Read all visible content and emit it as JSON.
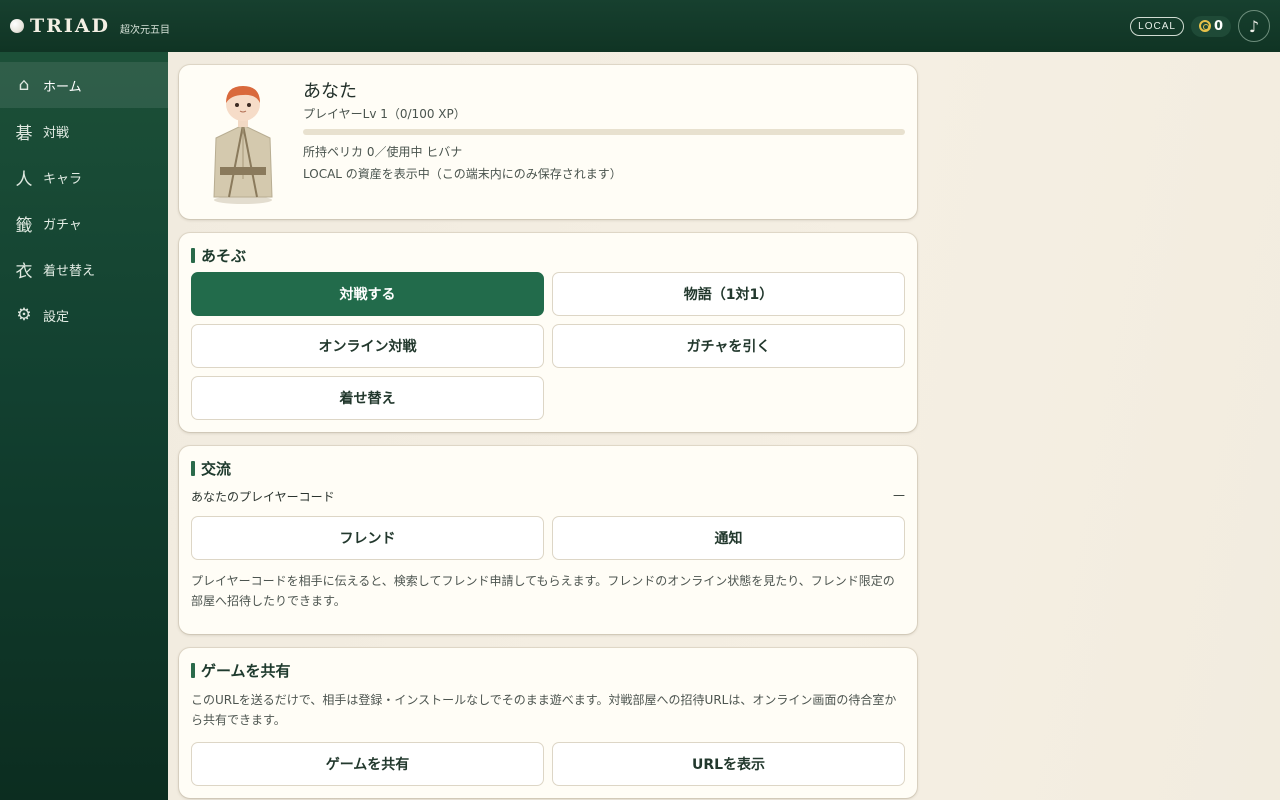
{
  "header": {
    "brand": "TRIAD",
    "brand_sub": "超次元五目",
    "mode_badge": "LOCAL",
    "coins": "0",
    "music_icon": "♪"
  },
  "sidebar": {
    "items": [
      {
        "icon": "⌂",
        "label": "ホーム",
        "active": true
      },
      {
        "icon": "碁",
        "label": "対戦"
      },
      {
        "icon": "人",
        "label": "キャラ"
      },
      {
        "icon": "籤",
        "label": "ガチャ"
      },
      {
        "icon": "衣",
        "label": "着せ替え"
      },
      {
        "icon": "⚙",
        "label": "設定"
      }
    ]
  },
  "profile": {
    "name": "あなた",
    "level": "プレイヤーLv 1（0/100 XP）",
    "xp_fraction": 0,
    "holdings": "所持ペリカ 0／使用中 ヒバナ",
    "storage_note": "LOCAL の資産を表示中（この端末内にのみ保存されます）"
  },
  "play": {
    "title": "あそぶ",
    "buttons": [
      "対戦する",
      "物語（1対1）",
      "オンライン対戦",
      "ガチャを引く",
      "着せ替え"
    ]
  },
  "social": {
    "title": "交流",
    "code_label": "あなたのプレイヤーコード",
    "code_value": "—",
    "buttons": [
      "フレンド",
      "通知"
    ],
    "description": "プレイヤーコードを相手に伝えると、検索してフレンド申請してもらえます。フレンドのオンライン状態を見たり、フレンド限定の部屋へ招待したりできます。"
  },
  "share": {
    "title": "ゲームを共有",
    "description": "このURLを送るだけで、相手は登録・インストールなしでそのまま遊べます。対戦部屋への招待URLは、オンライン画面の待合室から共有できます。",
    "buttons": [
      "ゲームを共有",
      "URLを表示"
    ]
  },
  "colors": {
    "header_bg": "#12392a",
    "sidebar_bg": "#15473a",
    "primary": "#226b4b",
    "page_bg": "#f3ede1",
    "card_bg": "#fffdf6"
  }
}
